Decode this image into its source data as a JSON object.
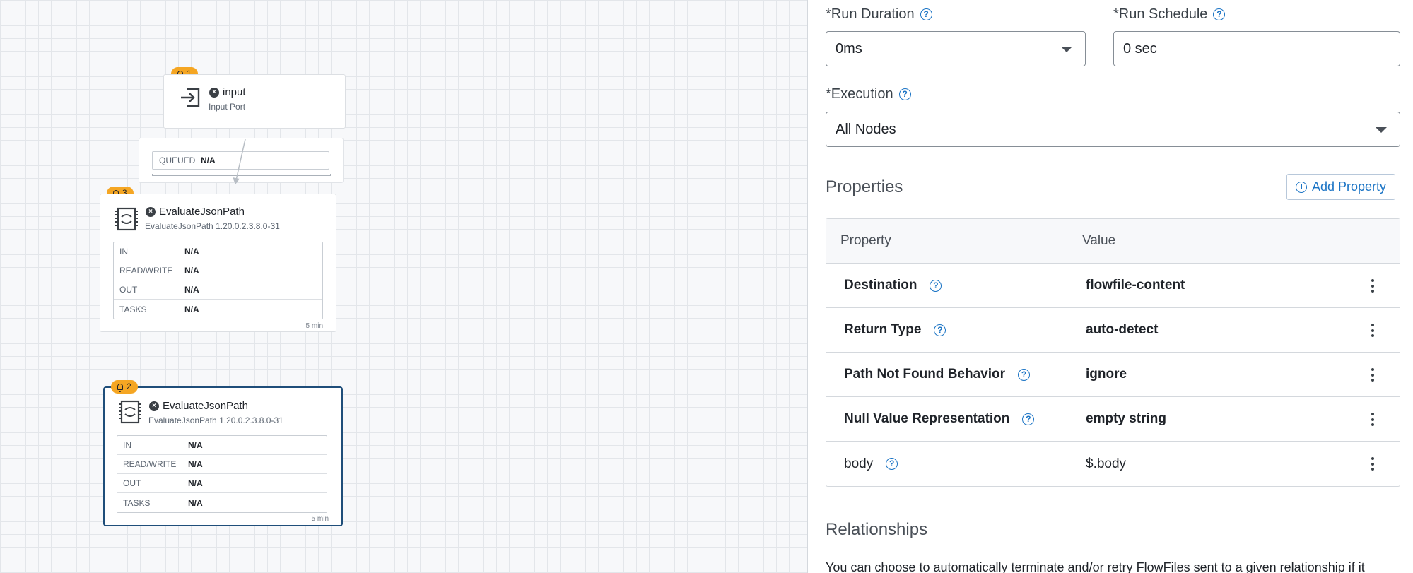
{
  "canvas": {
    "input_port": {
      "badge": "1",
      "name": "input",
      "type": "Input Port"
    },
    "connection": {
      "queued_label": "QUEUED",
      "queued_value": "N/A"
    },
    "processor_1": {
      "badge": "3",
      "name": "EvaluateJsonPath",
      "version": "EvaluateJsonPath 1.20.0.2.3.8.0-31",
      "stats": [
        {
          "label": "IN",
          "value": "N/A"
        },
        {
          "label": "READ/WRITE",
          "value": "N/A"
        },
        {
          "label": "OUT",
          "value": "N/A"
        },
        {
          "label": "TASKS",
          "value": "N/A"
        }
      ],
      "window": "5 min"
    },
    "processor_2": {
      "badge": "2",
      "name": "EvaluateJsonPath",
      "version": "EvaluateJsonPath 1.20.0.2.3.8.0-31",
      "stats": [
        {
          "label": "IN",
          "value": "N/A"
        },
        {
          "label": "READ/WRITE",
          "value": "N/A"
        },
        {
          "label": "OUT",
          "value": "N/A"
        },
        {
          "label": "TASKS",
          "value": "N/A"
        }
      ],
      "window": "5 min"
    }
  },
  "panel": {
    "run_duration": {
      "label": "*Run Duration",
      "value": "0ms"
    },
    "run_schedule": {
      "label": "*Run Schedule",
      "value": "0 sec"
    },
    "execution": {
      "label": "*Execution",
      "value": "All Nodes"
    },
    "properties": {
      "title": "Properties",
      "add_label": "Add Property",
      "header_property": "Property",
      "header_value": "Value",
      "rows": [
        {
          "name": "Destination",
          "value": "flowfile-content"
        },
        {
          "name": "Return Type",
          "value": "auto-detect"
        },
        {
          "name": "Path Not Found Behavior",
          "value": "ignore"
        },
        {
          "name": "Null Value Representation",
          "value": "empty string"
        },
        {
          "name": "body",
          "value": "$.body"
        }
      ]
    },
    "relationships": {
      "title": "Relationships",
      "description": "You can choose to automatically terminate and/or retry FlowFiles sent to a given relationship if it"
    }
  },
  "colors": {
    "accent": "#1b74c5",
    "badge": "#f5a623",
    "selected_border": "#1f4e7a"
  },
  "icons": [
    "bell-icon",
    "x-circle-icon",
    "input-port-icon",
    "processor-icon",
    "help-icon",
    "plus-circle-icon",
    "kebab-icon",
    "chevron-down-icon"
  ]
}
